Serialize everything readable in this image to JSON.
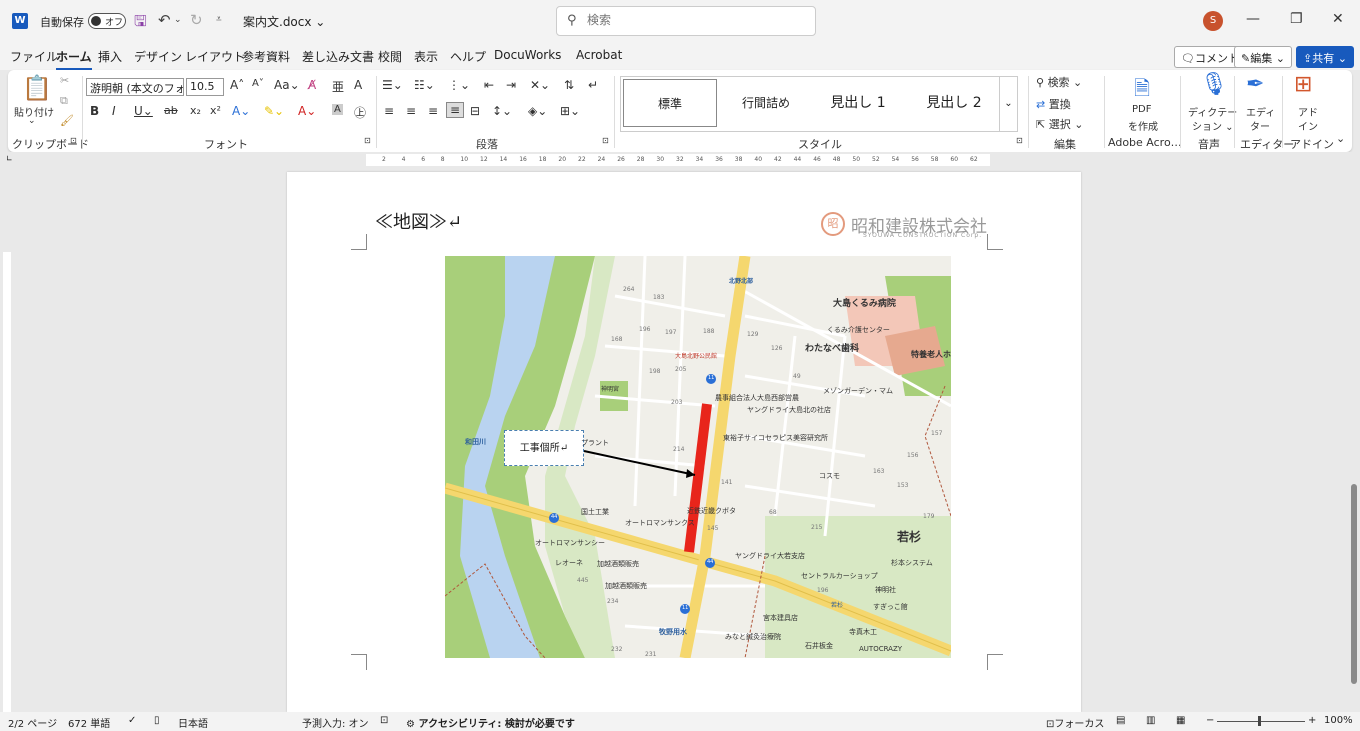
{
  "titlebar": {
    "app_logo": "W",
    "autosave_label": "自動保存",
    "autosave_state": "オフ",
    "doc_name": "案内文.docx",
    "search_placeholder": "検索",
    "user_initial": "S"
  },
  "menu": {
    "tabs": [
      "ファイル",
      "ホーム",
      "挿入",
      "デザイン",
      "レイアウト",
      "参考資料",
      "差し込み文書",
      "校閲",
      "表示",
      "ヘルプ",
      "DocuWorks",
      "Acrobat"
    ],
    "active_tab": "ホーム",
    "comment_label": "コメント",
    "edit_label": "編集",
    "share_label": "共有"
  },
  "ribbon": {
    "paste_label": "貼り付け",
    "font_name": "游明朝 (本文のフォ",
    "font_size": "10.5",
    "styles": [
      "標準",
      "行間詰め",
      "見出し 1",
      "見出し 2"
    ],
    "find_label": "検索",
    "replace_label": "置換",
    "select_label": "選択",
    "pdf_label_1": "PDF",
    "pdf_label_2": "を作成",
    "dictation_label_1": "ディクテー",
    "dictation_label_2": "ション",
    "editor_label_1": "エディ",
    "editor_label_2": "ター",
    "addin_label_1": "アド",
    "addin_label_2": "イン",
    "group_labels": {
      "clipboard": "クリップボード",
      "font": "フォント",
      "paragraph": "段落",
      "styles": "スタイル",
      "editing": "編集",
      "adobe": "Adobe Acro…",
      "voice": "音声",
      "editor": "エディター",
      "addins": "アドイン"
    }
  },
  "ruler": {
    "ticks": [
      "2",
      "4",
      "6",
      "8",
      "10",
      "12",
      "14",
      "16",
      "18",
      "20",
      "22",
      "24",
      "26",
      "28",
      "30",
      "32",
      "34",
      "36",
      "38",
      "40",
      "42",
      "44",
      "46",
      "48",
      "50",
      "52",
      "54",
      "56",
      "58",
      "60",
      "62"
    ]
  },
  "document": {
    "heading": "≪地図≫↵",
    "company_name": "昭和建設株式会社",
    "company_english": "SYOUWA CONSTRUCTION Corp.",
    "company_seal": "昭",
    "callout_text": "工事個所↵",
    "map_labels": {
      "kitanoh": "北野北部",
      "hospital": "大島くるみ病院",
      "care_center": "くるみ介護センター",
      "dental": "わたなべ歯科",
      "nursing": "特養老人ホ",
      "park": "大島北野公民館",
      "mezon": "メゾンガーデン・マム",
      "agri": "農事組合法人大島西部営農",
      "yangu1": "ヤングドライ大島北の社店",
      "tohnan": "東裕子サイコセラピス美容研究所",
      "jinja": "神明宮",
      "river": "和田川",
      "plant": "プラント",
      "kosumo": "コスモ",
      "kokudo": "国土工業",
      "auto1": "オートロマンサンクス",
      "auto2": "オートロマンサンシー",
      "kintetsu": "近鉄近畿クボタ",
      "wakasugi": "若杉",
      "reone": "レオーネ",
      "kaetsu1": "加越酒類販売",
      "kaetsu2": "加越酒類販売",
      "yangu2": "ヤングドライ大若支店",
      "central": "セントラルカーショップ",
      "sugimoto": "杉本システム",
      "jinja2": "神明社",
      "sugaku": "すぎっこ館",
      "miyamoto": "宮本建具店",
      "teramoto": "寺真木工",
      "makino": "牧野用水",
      "minami": "みなと鍼灸治療院",
      "ishii": "石井板金",
      "autocrazy": "AUTOCRAZY",
      "route11a": "11",
      "route11b": "11",
      "route44a": "44",
      "route44b": "44",
      "wakasugi_sign": "若杉",
      "n264": "264",
      "n183": "183",
      "n196": "196",
      "n197": "197",
      "n188": "188",
      "n129": "129",
      "n168": "168",
      "n198": "198",
      "n205": "205",
      "n126": "126",
      "n49": "49",
      "n203": "203",
      "n214": "214",
      "n157": "157",
      "n156": "156",
      "n163": "163",
      "n153": "153",
      "n141": "141",
      "n68": "68",
      "n215": "215",
      "n145": "145",
      "n179": "179",
      "n445": "445",
      "n234": "234",
      "n232": "232",
      "n231": "231",
      "n196b": "196"
    }
  },
  "status": {
    "page": "2/2 ページ",
    "words": "672 単語",
    "language": "日本語",
    "predict": "予測入力: オン",
    "accessibility": "アクセシビリティ: 検討が必要です",
    "focus": "フォーカス",
    "zoom": "100%"
  },
  "colors": {
    "brand": "#185abd",
    "road_yellow": "#f5d76e",
    "construction_red": "#e8251b",
    "river_blue": "#b9d3f0",
    "green": "#a8cf7a"
  }
}
